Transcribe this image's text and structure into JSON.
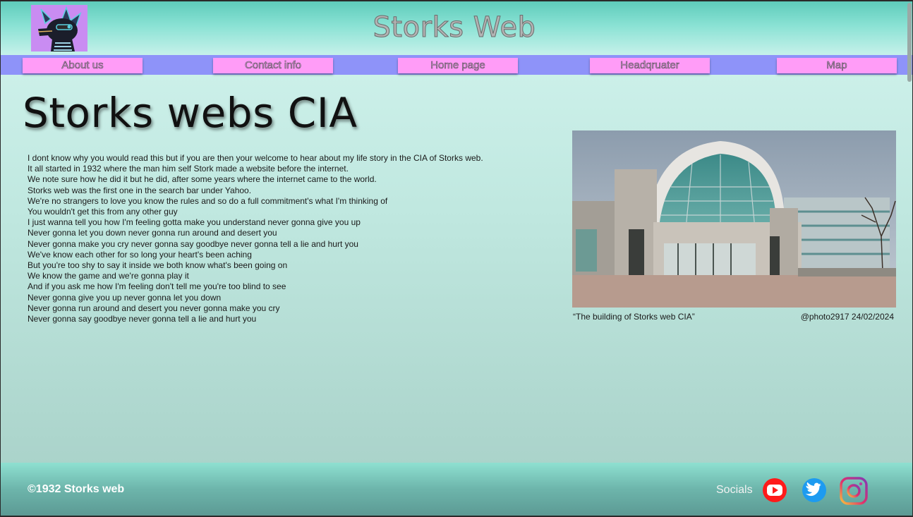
{
  "header": {
    "site_title": "Storks Web",
    "logo_icon": "dragon-avatar-logo"
  },
  "nav": {
    "items": [
      {
        "label": "About us"
      },
      {
        "label": "Contact info"
      },
      {
        "label": "Home page"
      },
      {
        "label": "Headqruater"
      },
      {
        "label": "Map"
      }
    ]
  },
  "main": {
    "title": "Storks webs CIA",
    "story_lines": [
      "I dont know why you would read this but if you are then your welcome to hear about my life story in the CIA of Storks web.",
      "It all started in 1932 where the man him self Stork made a website before the internet.",
      "We note sure how he did it but he did, after some years where the internet came to the world.",
      "Storks web was the first one in the search bar under Yahoo.",
      "We're no strangers to love you know the rules and so do a full commitment's what I'm thinking of",
      "You wouldn't get this from any other guy",
      "I just wanna tell you how I'm feeling gotta make you understand never gonna give you up",
      "Never gonna let you down never gonna run around and desert you",
      "Never gonna make you cry never gonna say goodbye never gonna tell a lie and hurt you",
      "We've know each other for so long your heart's been aching",
      "But you're too shy to say it inside we both know what's been going on",
      "We know the game and we're gonna play it",
      "And if you ask me how I'm feeling don't tell me you're too blind to see",
      "Never gonna give you up never gonna let you down",
      "Never gonna run around and desert you never gonna make you cry",
      "Never gonna say goodbye never gonna tell a lie and hurt you"
    ],
    "photo": {
      "caption": "“The building of Storks web CIA”",
      "credit": "@photo2917 24/02/2024"
    }
  },
  "footer": {
    "copyright": "©1932 Storks web",
    "socials_label": "Socials",
    "socials": [
      {
        "icon": "youtube-icon",
        "color": "#ff0000"
      },
      {
        "icon": "twitter-icon",
        "color": "#1d9bf0"
      },
      {
        "icon": "instagram-icon",
        "color": "#e1306c"
      }
    ]
  },
  "colors": {
    "nav_bar": "#8e93f9",
    "nav_button": "#ff9cf7",
    "logo_bg": "#c98cf2"
  }
}
